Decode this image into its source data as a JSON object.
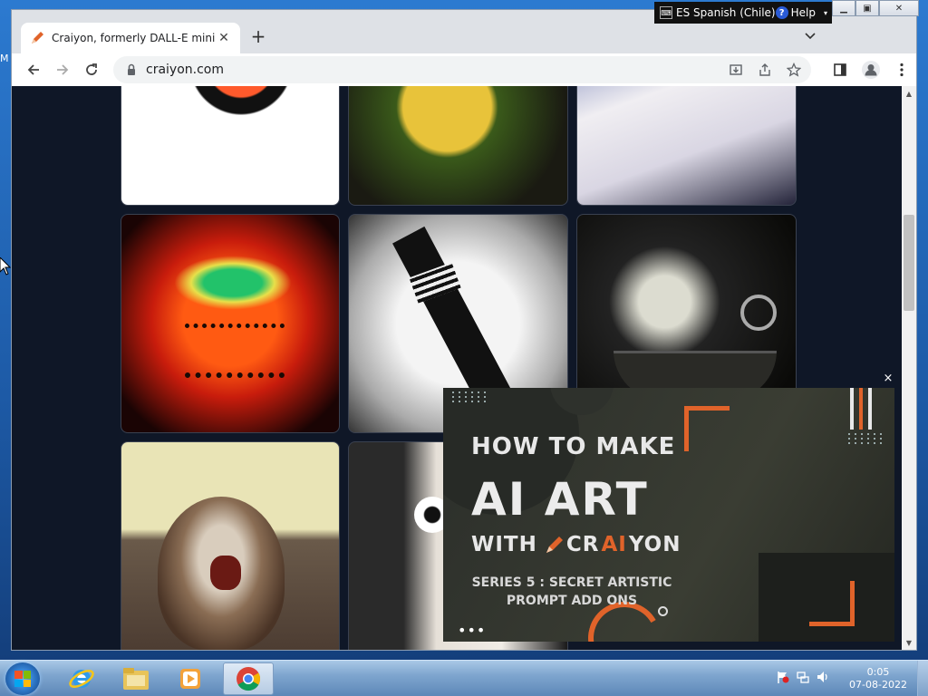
{
  "desktop": {
    "left_edge_text": "M"
  },
  "language_bar": {
    "language": "ES Spanish (Chile)",
    "help_label": "Help"
  },
  "browser": {
    "tab": {
      "title": "Craiyon, formerly DALL-E mini"
    },
    "new_tab_symbol": "+",
    "tab_search_symbol": "⌄",
    "address": {
      "url": "craiyon.com"
    },
    "toolbar_icons": [
      "back-icon",
      "forward-icon",
      "reload-icon",
      "lock-icon",
      "install-icon",
      "share-icon",
      "bookmark-star-icon",
      "side-panel-icon",
      "profile-icon",
      "menu-icon"
    ]
  },
  "page": {
    "grid_images": [
      {
        "name": "generated-image-1"
      },
      {
        "name": "generated-image-2"
      },
      {
        "name": "generated-image-3"
      },
      {
        "name": "generated-image-4"
      },
      {
        "name": "generated-image-5"
      },
      {
        "name": "generated-image-6"
      },
      {
        "name": "generated-image-7"
      },
      {
        "name": "generated-image-8"
      }
    ]
  },
  "video": {
    "close_symbol": "×",
    "line1": "HOW TO MAKE",
    "line2": "AI ART",
    "line3_prefix": "WITH",
    "brand_a": "CR",
    "brand_b": "AI",
    "brand_c": "YON",
    "series_line1": "SERIES 5 : SECRET ARTISTIC",
    "series_line2": "PROMPT ADD ONS",
    "more_dots": "•••",
    "accent_color": "#e0632a"
  },
  "taskbar": {
    "apps": [
      "internet-explorer-icon",
      "file-explorer-icon",
      "media-player-icon",
      "chrome-icon"
    ],
    "clock_time": "0:05",
    "clock_date": "07-08-2022"
  }
}
